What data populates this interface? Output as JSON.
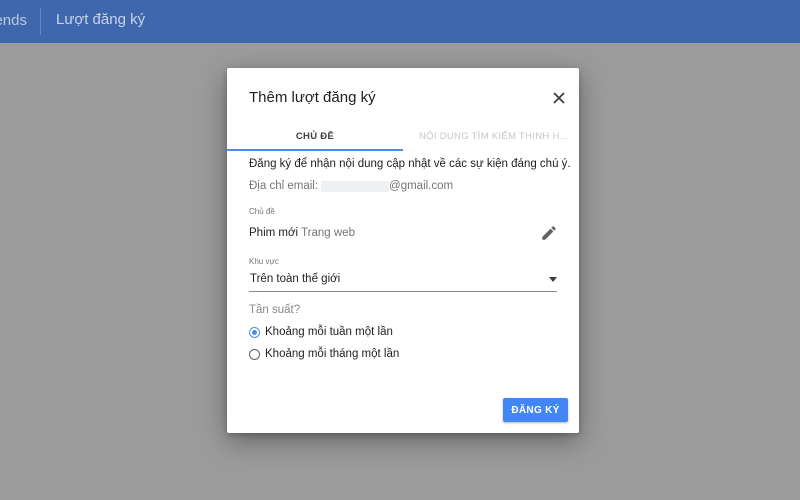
{
  "appbar": {
    "brand": "ends",
    "title": "Lượt đăng ký"
  },
  "dialog": {
    "title": "Thêm lượt đăng ký",
    "close_icon": "close-icon",
    "tabs": [
      {
        "label": "CHỦ ĐỀ",
        "active": true
      },
      {
        "label": "NỘI DUNG TÌM KIẾM THỊNH H...",
        "active": false
      }
    ],
    "description": "Đăng ký để nhận nội dung cập nhật về các sự kiện đáng chú ý.",
    "email": {
      "label": "Địa chỉ email:",
      "domain": "@gmail.com"
    },
    "topic": {
      "label": "Chủ đề",
      "name": "Phim mới",
      "type": "Trang web",
      "edit_icon": "pencil-icon"
    },
    "region": {
      "label": "Khu vực",
      "value": "Trên toàn thế giới",
      "arrow_icon": "dropdown-arrow-icon"
    },
    "frequency": {
      "label": "Tần suất?",
      "options": [
        {
          "label": "Khoảng mỗi tuần một lần",
          "checked": true
        },
        {
          "label": "Khoảng mỗi tháng một lần",
          "checked": false
        }
      ]
    },
    "submit_label": "ĐĂNG KÝ"
  },
  "colors": {
    "appbar": "#3f67ad",
    "accent": "#4285f4",
    "overlay": "#9b9b9b"
  }
}
